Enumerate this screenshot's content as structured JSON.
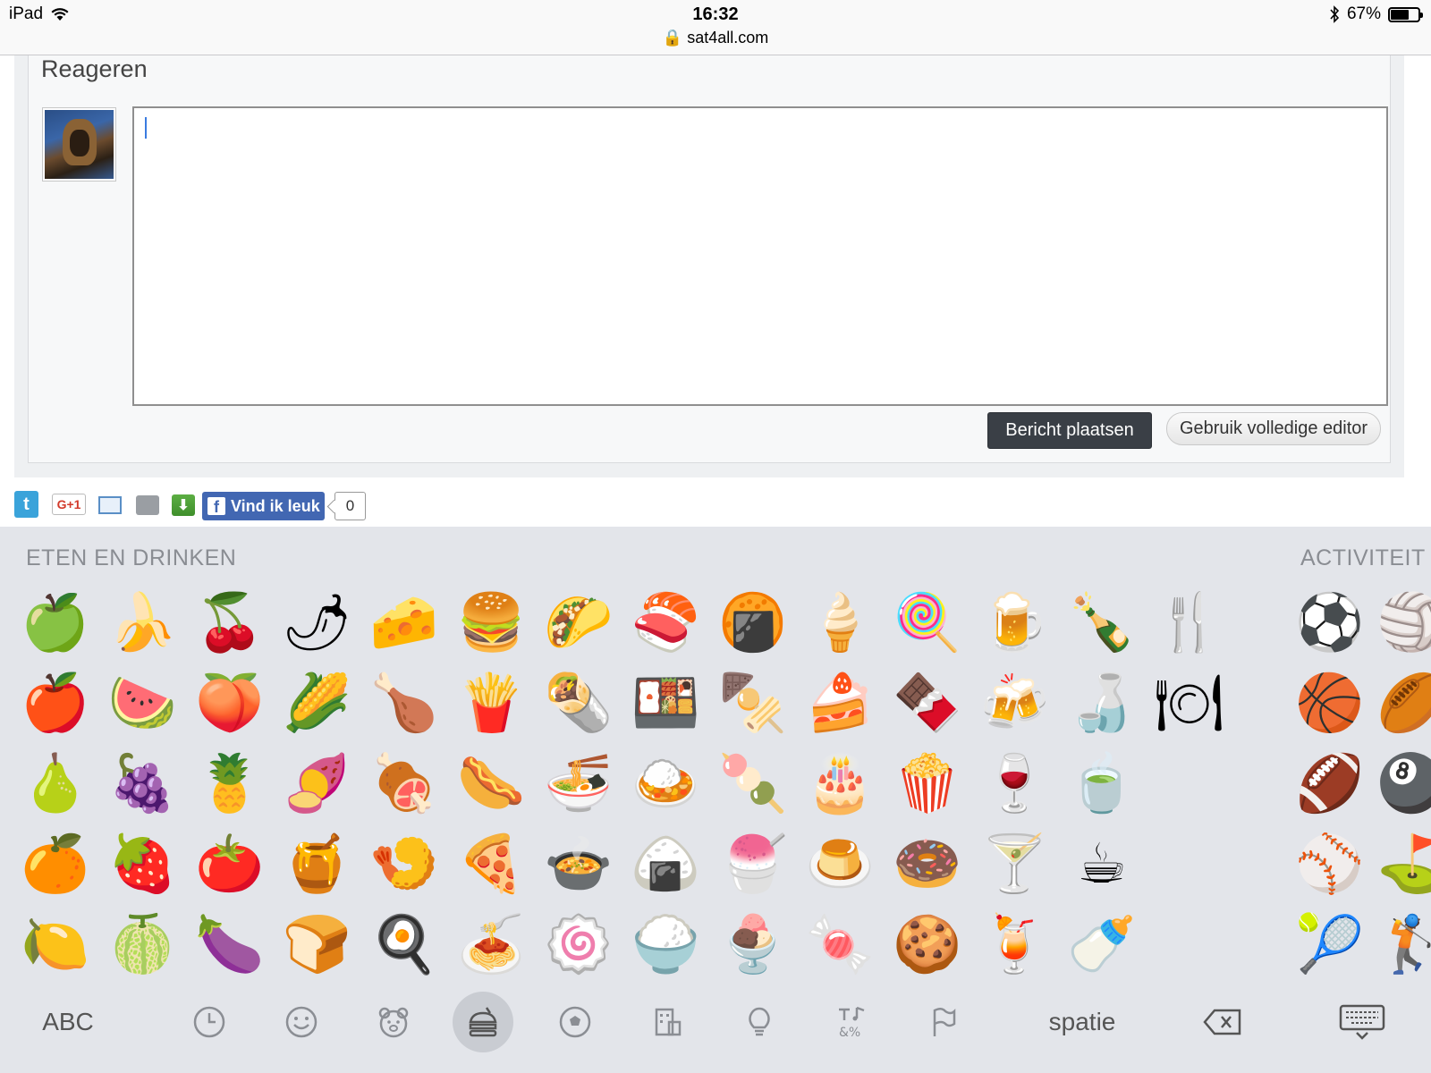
{
  "status": {
    "device": "iPad",
    "time": "16:32",
    "url": "sat4all.com",
    "battery": "67%",
    "battery_level": 0.67
  },
  "reply": {
    "title": "Reageren",
    "post_button": "Bericht plaatsen",
    "editor_button": "Gebruik volledige editor"
  },
  "share": {
    "twitter_glyph": "t",
    "gplus_label": "G+1",
    "like_label": "Vind ik leuk",
    "facebook_glyph": "f",
    "like_count": "0"
  },
  "keyboard": {
    "category_food": "ETEN EN DRINKEN",
    "category_activity": "ACTIVITEIT",
    "food_emojis": [
      [
        "🍏",
        "🍌",
        "🍒",
        "🌶",
        "🧀",
        "🍔",
        "🌮",
        "🍣",
        "🍘",
        "🍦",
        "🍭",
        "🍺",
        "🍾",
        "🍴"
      ],
      [
        "🍎",
        "🍉",
        "🍑",
        "🌽",
        "🍗",
        "🍟",
        "🌯",
        "🍱",
        "🍢",
        "🍰",
        "🍫",
        "🍻",
        "🍶",
        "🍽"
      ],
      [
        "🍐",
        "🍇",
        "🍍",
        "🍠",
        "🍖",
        "🌭",
        "🍜",
        "🍛",
        "🍡",
        "🎂",
        "🍿",
        "🍷",
        "🍵",
        ""
      ],
      [
        "🍊",
        "🍓",
        "🍅",
        "🍯",
        "🍤",
        "🍕",
        "🍲",
        "🍙",
        "🍧",
        "🍮",
        "🍩",
        "🍸",
        "☕",
        ""
      ],
      [
        "🍋",
        "🍈",
        "🍆",
        "🍞",
        "🍳",
        "🍝",
        "🍥",
        "🍚",
        "🍨",
        "🍬",
        "🍪",
        "🍹",
        "🍼",
        ""
      ]
    ],
    "activity_emojis": [
      [
        "⚽",
        "🏐"
      ],
      [
        "🏀",
        "🏉"
      ],
      [
        "🏈",
        "🎱"
      ],
      [
        "⚾",
        "⛳"
      ],
      [
        "🎾",
        "🏌"
      ]
    ],
    "abc_label": "ABC",
    "space_label": "spatie",
    "icons": [
      "clock-icon",
      "smiley-icon",
      "bear-icon",
      "burger-icon",
      "ball-icon",
      "building-icon",
      "bulb-icon",
      "symbols-icon",
      "flag-icon"
    ]
  }
}
